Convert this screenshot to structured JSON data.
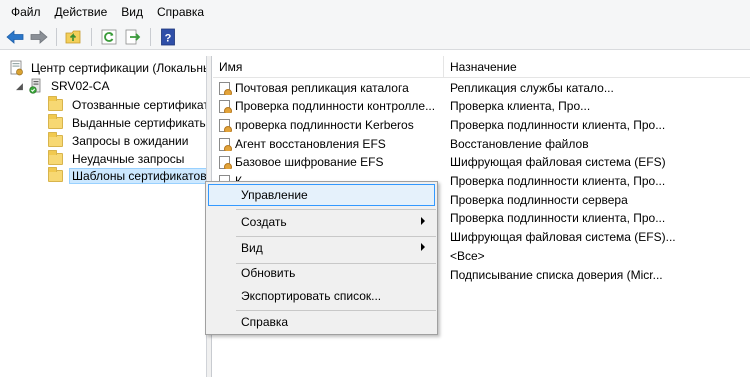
{
  "menubar": {
    "items": [
      "Файл",
      "Действие",
      "Вид",
      "Справка"
    ]
  },
  "toolbar": {
    "buttons": [
      "back-icon",
      "forward-icon",
      "up-folder-icon",
      "refresh-icon",
      "export-icon",
      "help-icon"
    ],
    "accent": "#1f5fbf"
  },
  "tree": {
    "root": "Центр сертификации (Локальный)",
    "server": "SRV02-CA",
    "items": [
      "Отозванные сертификаты",
      "Выданные сертификаты",
      "Запросы в ожидании",
      "Неудачные запросы",
      "Шаблоны сертификатов"
    ],
    "selected": "Шаблоны сертификатов"
  },
  "list": {
    "columns": [
      "Имя",
      "Назначение"
    ],
    "rows": [
      {
        "name": "Почтовая репликация каталога",
        "purpose": "Репликация службы катало..."
      },
      {
        "name": "Проверка подлинности контролле...",
        "purpose": "Проверка клиента, Про..."
      },
      {
        "name": "проверка подлинности Kerberos",
        "purpose": "Проверка подлинности клиента, Про..."
      },
      {
        "name": "Агент восстановления EFS",
        "purpose": "Восстановление файлов"
      },
      {
        "name": "Базовое шифрование EFS",
        "purpose": "Шифрующая файловая система (EFS)"
      },
      {
        "name": "К",
        "purpose": "Проверка подлинности клиента, Про..."
      },
      {
        "name": "",
        "purpose": "Проверка подлинности сервера"
      },
      {
        "name": "",
        "purpose": "Проверка подлинности клиента, Про..."
      },
      {
        "name": "",
        "purpose": "Шифрующая файловая система (EFS)..."
      },
      {
        "name": "",
        "purpose": "<Все>"
      },
      {
        "name": "",
        "purpose": "Подписывание списка доверия (Micr..."
      }
    ]
  },
  "context_menu": {
    "items": [
      {
        "label": "Управление",
        "submenu": false,
        "highlighted": true
      },
      {
        "label": "Создать",
        "submenu": true
      },
      {
        "label": "Вид",
        "submenu": true
      },
      {
        "label": "Обновить",
        "submenu": false
      },
      {
        "label": "Экспортировать список...",
        "submenu": false
      },
      {
        "label": "Справка",
        "submenu": false
      }
    ]
  }
}
